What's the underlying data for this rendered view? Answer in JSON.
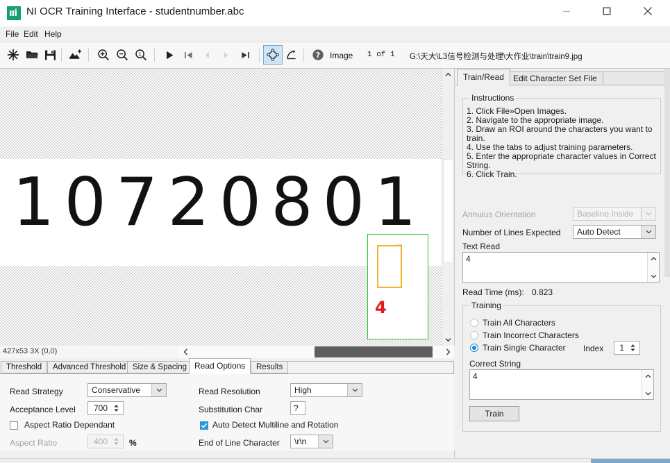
{
  "window": {
    "title": "NI OCR Training Interface - studentnumber.abc",
    "logo_icon": "ni-logo-icon",
    "minimize_icon": "minimize-icon",
    "maximize_icon": "maximize-icon",
    "close_icon": "close-icon"
  },
  "menubar": {
    "items": [
      "File",
      "Edit",
      "Help"
    ]
  },
  "toolbar": {
    "icons": [
      "new-icon",
      "open-folder-icon",
      "save-icon",
      "add-image-icon",
      "zoom-in-icon",
      "zoom-out-icon",
      "zoom-actual-size-icon",
      "play-icon",
      "first-image-icon",
      "previous-image-icon",
      "next-image-icon",
      "last-image-icon",
      "roi-tool-icon",
      "rotate-roi-icon",
      "help-icon"
    ],
    "image_label": "Image",
    "image_index": "1 of 1",
    "image_path": "G:\\天大\\L3信号检测与处理\\大作业\\train\\train9.jpg"
  },
  "canvas": {
    "digits": "10720801",
    "roi_char_glyph": "4",
    "roi_char_label": "4",
    "roi_border_color": "#2ec82e",
    "char_box_color": "#f0b429",
    "char_fill_color": "#9b28d0",
    "char_label_color": "#e01b1b",
    "vscroll_up_icon": "chevron-up-icon",
    "vscroll_down_icon": "chevron-down-icon"
  },
  "statusbar": {
    "text": "427x53 3X   (0,0)",
    "hscroll_left_icon": "chevron-left-icon",
    "hscroll_right_icon": "chevron-right-icon"
  },
  "bottom_tabs": {
    "items": [
      {
        "label": "Threshold",
        "active": false
      },
      {
        "label": "Advanced Threshold",
        "active": false
      },
      {
        "label": "Size & Spacing",
        "active": false
      },
      {
        "label": "Read Options",
        "active": true
      },
      {
        "label": "Results",
        "active": false
      }
    ]
  },
  "read_options": {
    "read_strategy_label": "Read Strategy",
    "read_strategy_value": "Conservative",
    "acceptance_level_label": "Acceptance Level",
    "acceptance_level_value": "700",
    "aspect_ratio_dependant_label": "Aspect Ratio Dependant",
    "aspect_ratio_dependant_checked": false,
    "aspect_ratio_label": "Aspect Ratio",
    "aspect_ratio_value": "400",
    "aspect_ratio_unit": "%",
    "read_resolution_label": "Read Resolution",
    "read_resolution_value": "High",
    "substitution_char_label": "Substitution Char",
    "substitution_char_value": "?",
    "auto_detect_label": "Auto Detect Multiline and Rotation",
    "auto_detect_checked": true,
    "end_of_line_label": "End of Line Character",
    "end_of_line_value": "\\r\\n"
  },
  "right_panel": {
    "tabs": [
      {
        "label": "Train/Read",
        "active": true
      },
      {
        "label": "Edit Character Set File",
        "active": false
      }
    ],
    "instructions_title": "Instructions",
    "instructions": [
      "1. Click File»Open Images.",
      "2. Navigate to the appropriate image.",
      "3. Draw an ROI around the characters you want to",
      "train.",
      "4. Use the tabs to adjust training parameters.",
      "5. Enter the appropriate character values in Correct",
      "String.",
      "6. Click Train."
    ],
    "annulus_label": "Annulus Orientation",
    "annulus_value": "Baseline Inside",
    "lines_expected_label": "Number of Lines Expected",
    "lines_expected_value": "Auto Detect",
    "text_read_label": "Text Read",
    "text_read_value": "4",
    "read_time_label": "Read Time (ms):",
    "read_time_value": "0.823",
    "training_title": "Training",
    "radio_all": "Train All Characters",
    "radio_incorrect": "Train Incorrect Characters",
    "radio_single": "Train Single Character",
    "selected_radio": "single",
    "index_label": "Index",
    "index_value": "1",
    "correct_string_label": "Correct String",
    "correct_string_value": "4",
    "train_button": "Train"
  }
}
